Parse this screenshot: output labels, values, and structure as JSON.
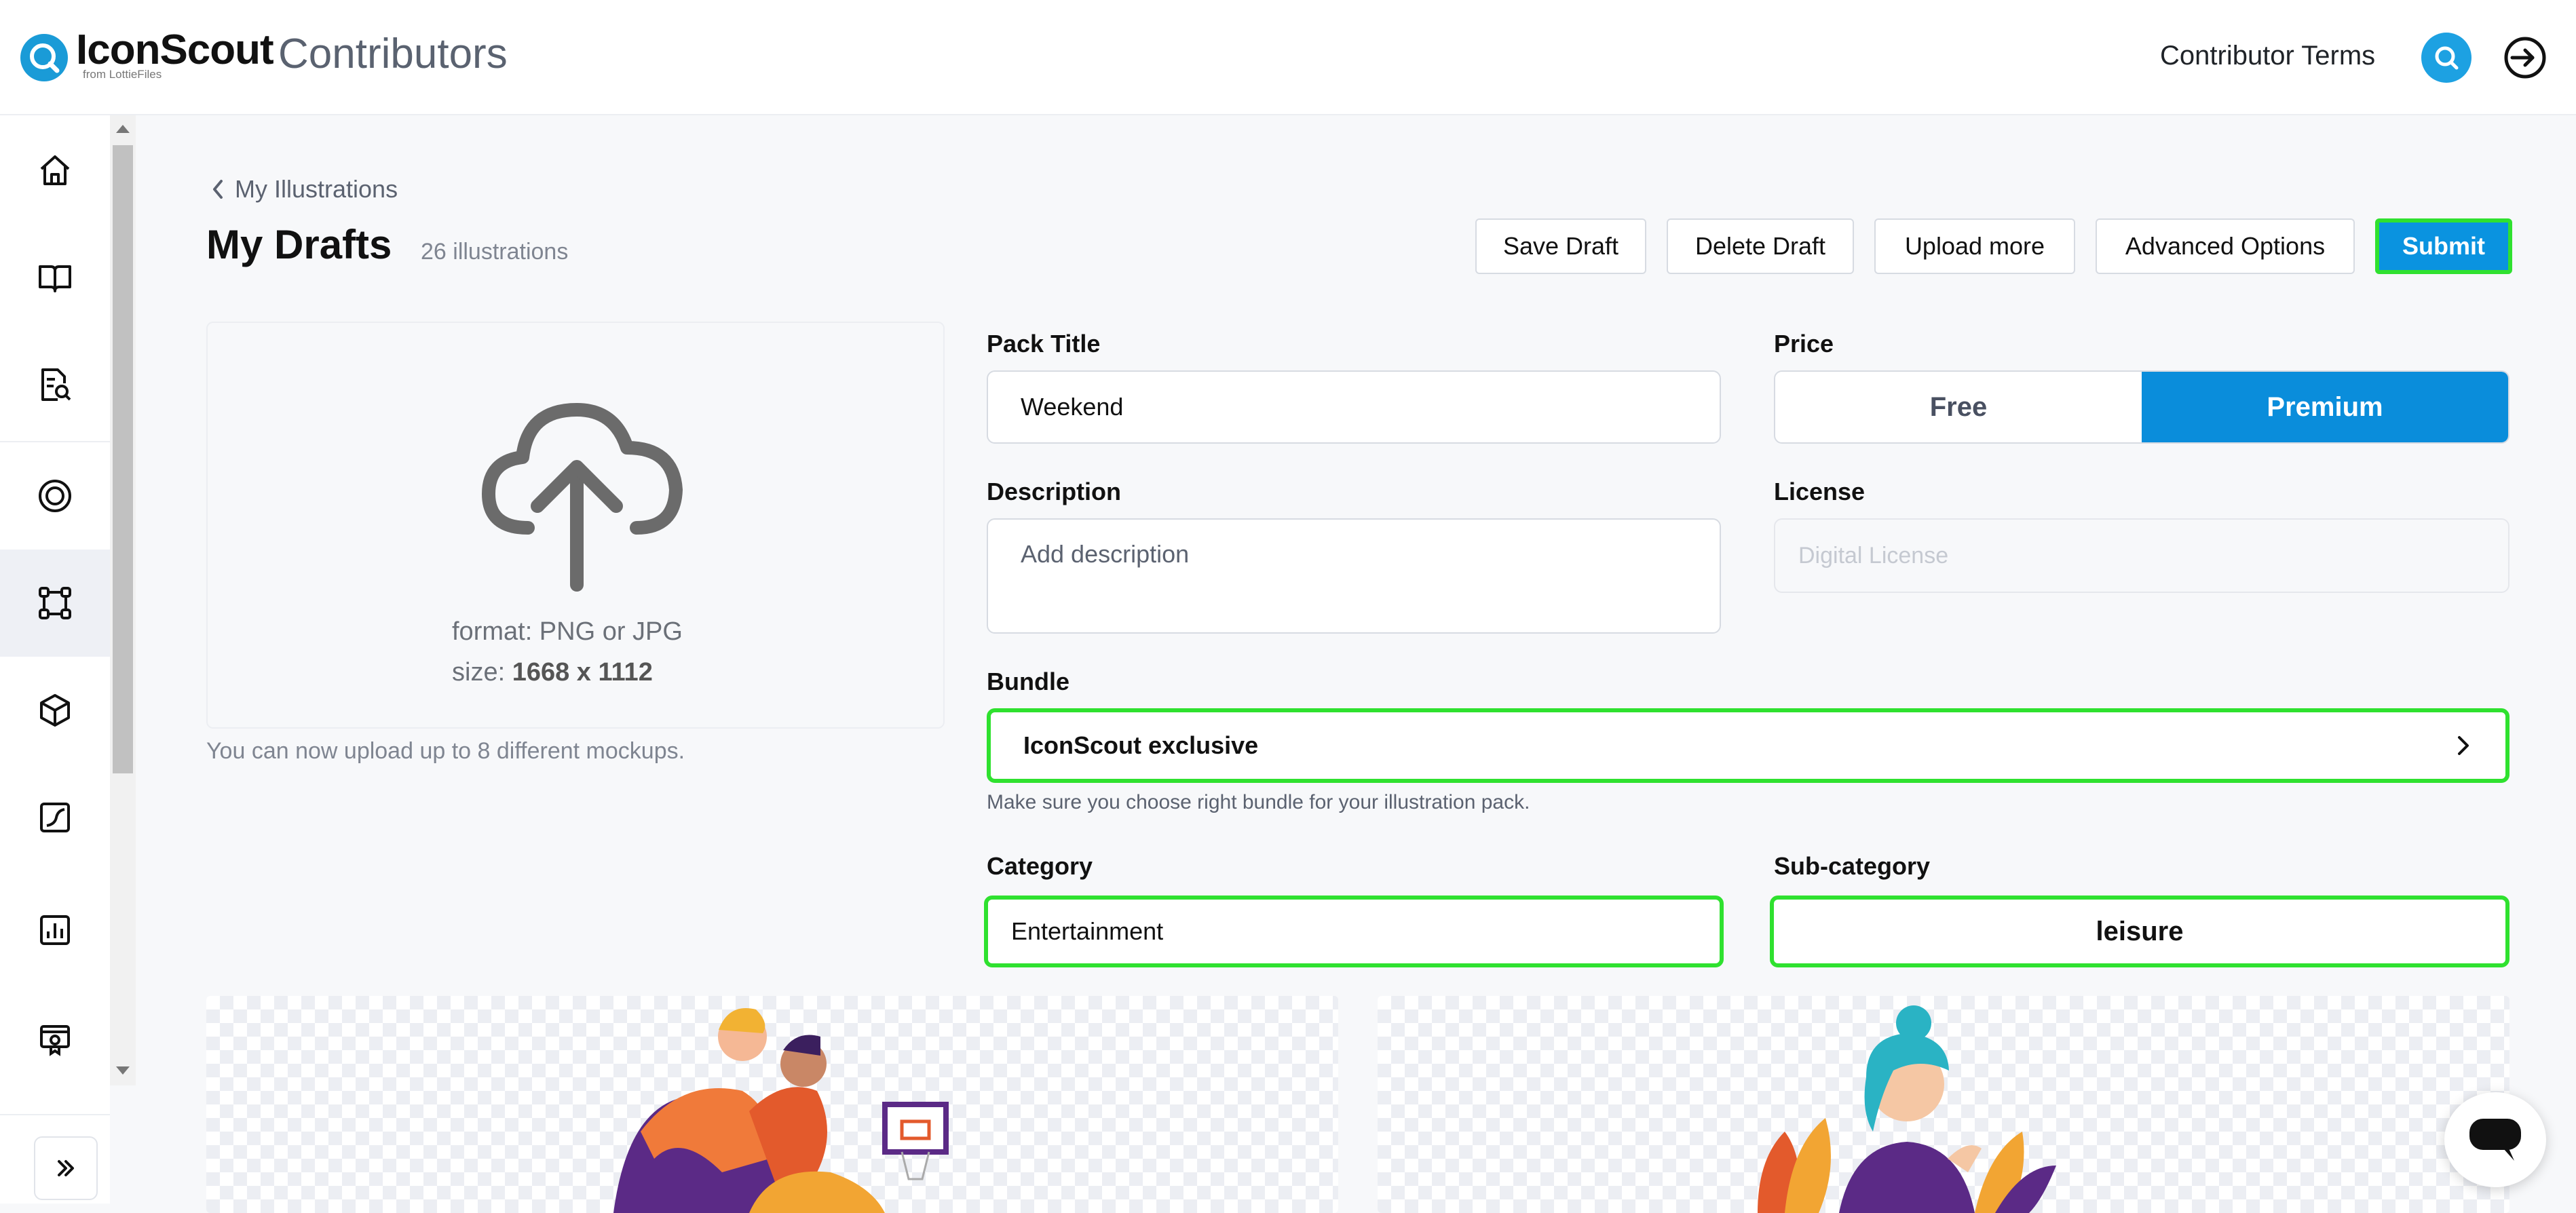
{
  "header": {
    "logo_text": "IconScout",
    "logo_sub": "from LottieFiles",
    "app_title": "Contributors",
    "terms_link": "Contributor Terms"
  },
  "sidebar": {
    "items": [
      "home-icon",
      "book-icon",
      "file-search-icon",
      "target-icon",
      "vector-frame-icon",
      "cube-icon",
      "chart-line-icon",
      "bar-chart-icon",
      "badge-icon"
    ],
    "active_index": 4,
    "expand_icon": "chevron-double-right-icon"
  },
  "main": {
    "back_link": "My Illustrations",
    "title": "My Drafts",
    "count": "26 illustrations",
    "actions": {
      "save_draft": "Save Draft",
      "delete_draft": "Delete Draft",
      "upload_more": "Upload more",
      "advanced_options": "Advanced Options",
      "submit": "Submit"
    },
    "upload": {
      "format": "format: PNG or JPG",
      "size_label": "size: ",
      "size_value": "1668 x 1112",
      "note": "You can now upload up to 8 different mockups."
    },
    "form": {
      "pack_title_label": "Pack Title",
      "pack_title_value": "Weekend",
      "price_label": "Price",
      "price_options": [
        "Free",
        "Premium"
      ],
      "price_selected": "Premium",
      "description_label": "Description",
      "description_placeholder": "Add description",
      "license_label": "License",
      "license_placeholder": "Digital License",
      "bundle_label": "Bundle",
      "bundle_value": "IconScout exclusive",
      "bundle_helper": "Make sure you choose right bundle for your illustration pack.",
      "category_label": "Category",
      "category_value": "Entertainment",
      "subcategory_label": "Sub-category",
      "subcategory_value": "leisure"
    }
  },
  "colors": {
    "accent": "#0a93e0",
    "highlight": "#2fe12f"
  }
}
